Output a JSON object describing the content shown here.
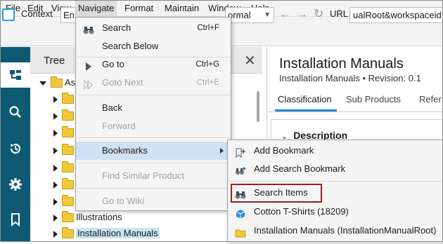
{
  "menubar": {
    "items": [
      "File",
      "Edit",
      "View",
      "Navigate",
      "Format",
      "Maintain",
      "Window",
      "Help"
    ]
  },
  "toolbar": {
    "context_label": "Context",
    "context_value": "En",
    "view_value": "ormal",
    "url_label": "URL",
    "url_value": "ualRoot&workspaceid"
  },
  "leftbar": {
    "icons": [
      "tree-icon",
      "search-icon",
      "history-icon",
      "gear-icon",
      "bookmark-icon"
    ]
  },
  "tree": {
    "title": "Tree",
    "root_label": "As",
    "rows": [
      {
        "label": "Illustrations"
      },
      {
        "label": "Installation Manuals"
      }
    ]
  },
  "detail": {
    "title": "Installation Manuals",
    "subtitle": "Installation Manuals • Revision: 0.1",
    "tabs": [
      "Classification",
      "Sub Products",
      "Refer"
    ],
    "section": "Description"
  },
  "navigate_menu": {
    "items": [
      {
        "label": "Search",
        "shortcut": "Ctrl+F",
        "disabled": false
      },
      {
        "label": "Search Below",
        "shortcut": "",
        "disabled": false
      },
      {
        "label": "Go to",
        "shortcut": "Ctrl+G",
        "disabled": false
      },
      {
        "label": "Goto Next",
        "shortcut": "Ctrl+E",
        "disabled": true
      },
      {
        "label": "Back",
        "shortcut": "",
        "disabled": false
      },
      {
        "label": "Forward",
        "shortcut": "",
        "disabled": true
      },
      {
        "label": "Bookmarks",
        "shortcut": "",
        "disabled": false
      },
      {
        "label": "Find Similar Product",
        "shortcut": "",
        "disabled": true
      },
      {
        "label": "Go to Wiki",
        "shortcut": "",
        "disabled": true
      }
    ]
  },
  "bookmarks_menu": {
    "items": [
      {
        "label": "Add Bookmark"
      },
      {
        "label": "Add Search Bookmark"
      },
      {
        "label": "Search Items"
      },
      {
        "label": "Cotton T-Shirts (18209)"
      },
      {
        "label": "Installation Manuals (InstallationManualRoot)"
      }
    ]
  },
  "colors": {
    "leftbar": "#0e5a73",
    "highlight": "#cfe2f3",
    "focus_border": "#9b2020",
    "accent": "#1f8ad0"
  }
}
